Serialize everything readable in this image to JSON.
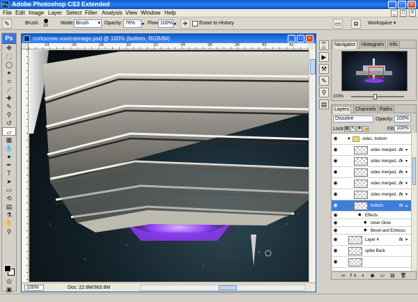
{
  "app": {
    "title": "Adobe Photoshop CS3 Extended",
    "logo": "Ps"
  },
  "window_buttons": {
    "minimize": "_",
    "maximize": "□",
    "close": "×"
  },
  "menu": [
    "File",
    "Edit",
    "Image",
    "Layer",
    "Select",
    "Filter",
    "Analysis",
    "View",
    "Window",
    "Help"
  ],
  "options": {
    "brush_label": "Brush:",
    "brush_size": "15",
    "mode_label": "Mode:",
    "mode_value": "Brush",
    "opacity_label": "Opacity:",
    "opacity_value": "76%",
    "flow_label": "Flow:",
    "flow_value": "100%",
    "erase_history_label": "Erase to History",
    "workspace_label": "Workspace ▾"
  },
  "tools_badge": "Ps",
  "document": {
    "title": "corkscrew sourceimage.psd @ 100% (bottom, RGB/8#)",
    "ruler_ticks": [
      "24",
      "26",
      "28",
      "30",
      "32",
      "34",
      "36",
      "38",
      "40",
      "42"
    ],
    "zoom": "100%",
    "doc_info": "Doc: 22.8M/363.8M"
  },
  "navigator": {
    "tabs": [
      "Navigator",
      "Histogram",
      "Info"
    ],
    "zoom": "100%"
  },
  "layers": {
    "tabs": [
      "Layers",
      "Channels",
      "Paths"
    ],
    "blend_mode": "Dissolve",
    "opacity_label": "Opacity:",
    "opacity_value": "100%",
    "lock_label": "Lock:",
    "fill_label": "Fill:",
    "fill_value": "100%",
    "group_name": "sides, bottom",
    "rows": [
      {
        "name": "sides merged...",
        "fx": "fx"
      },
      {
        "name": "sides merged...",
        "fx": "fx"
      },
      {
        "name": "sides merged...",
        "fx": "fx"
      },
      {
        "name": "sides merged...",
        "fx": "fx"
      },
      {
        "name": "sides merged...",
        "fx": "fx"
      }
    ],
    "selected_layer": {
      "name": "bottom",
      "fx": "fx"
    },
    "effects_label": "Effects",
    "effects": [
      "Inner Glow",
      "Bevel and Emboss"
    ],
    "after_rows": [
      {
        "name": "Layer 4",
        "fx": "fx"
      },
      {
        "name": "spike Back",
        "fx": ""
      }
    ],
    "footer_icons": "∞ fx ◐ ◉ ▭ ▤ 🗑"
  },
  "colors": {
    "titlebar": "#0a5ccd",
    "selection": "#3d7fd9",
    "glow": "#8a3cf0"
  }
}
